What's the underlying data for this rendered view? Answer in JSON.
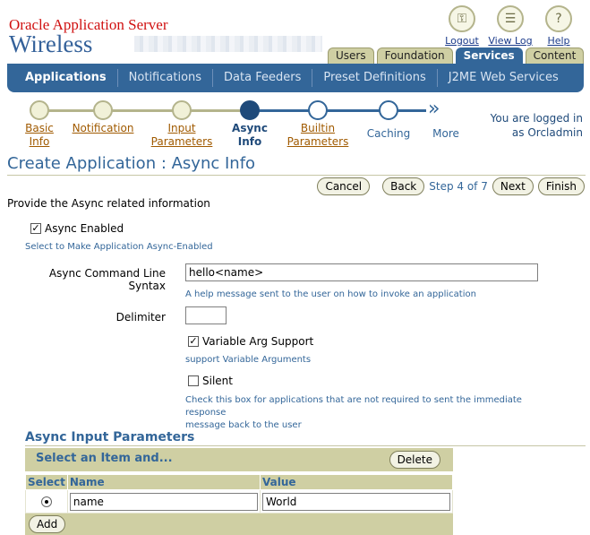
{
  "brand": {
    "line1": "Oracle Application Server",
    "line2": "Wireless"
  },
  "global_icons": [
    {
      "label": "Logout",
      "icon": "logout-key-icon",
      "glyph": "⚿"
    },
    {
      "label": "View Log",
      "icon": "view-log-icon",
      "glyph": "☰"
    },
    {
      "label": "Help",
      "icon": "help-icon",
      "glyph": "?"
    }
  ],
  "top_tabs": [
    "Users",
    "Foundation",
    "Services",
    "Content"
  ],
  "active_top_tab": "Services",
  "sub_tabs": [
    "Applications",
    "Notifications",
    "Data Feeders",
    "Preset Definitions",
    "J2ME Web Services"
  ],
  "train": {
    "steps": [
      {
        "label1": "Basic",
        "label2": "Info",
        "state": "visited"
      },
      {
        "label1": "Notification",
        "label2": "",
        "state": "visited"
      },
      {
        "label1": "Input",
        "label2": "Parameters",
        "state": "visited"
      },
      {
        "label1": "Async",
        "label2": "Info",
        "state": "current"
      },
      {
        "label1": "Builtin",
        "label2": "Parameters",
        "state": "next"
      },
      {
        "label1": "Caching",
        "label2": "",
        "state": "unvisited"
      }
    ],
    "more_label": "More"
  },
  "login": {
    "line1": "You are logged in",
    "line2": "as Orcladmin"
  },
  "page_title": "Create Application : Async Info",
  "buttons": {
    "cancel": "Cancel",
    "back": "Back",
    "step": "Step 4 of 7",
    "next": "Next",
    "finish": "Finish"
  },
  "instruction": "Provide the Async related information",
  "form": {
    "async_enabled": {
      "label": "Async Enabled",
      "checked": true,
      "tip": "Select to Make Application Async-Enabled"
    },
    "command_syntax": {
      "label": "Async Command Line Syntax",
      "value": "hello<name>",
      "tip": "A help message sent to the user on how to invoke an application"
    },
    "delimiter": {
      "label": "Delimiter",
      "value": ""
    },
    "variable_arg": {
      "label": "Variable Arg Support",
      "checked": true,
      "tip": "support Variable Arguments"
    },
    "silent": {
      "label": "Silent",
      "checked": false,
      "tip_line1": "Check this box for applications that are not required to sent the immediate response",
      "tip_line2": "message back to the user"
    }
  },
  "params_section": {
    "title": "Async Input Parameters",
    "header_text": "Select an Item and...",
    "delete_label": "Delete",
    "columns": [
      "Select",
      "Name",
      "Value"
    ],
    "rows": [
      {
        "name": "name",
        "value": "World",
        "selected": true
      }
    ],
    "add_label": "Add"
  }
}
